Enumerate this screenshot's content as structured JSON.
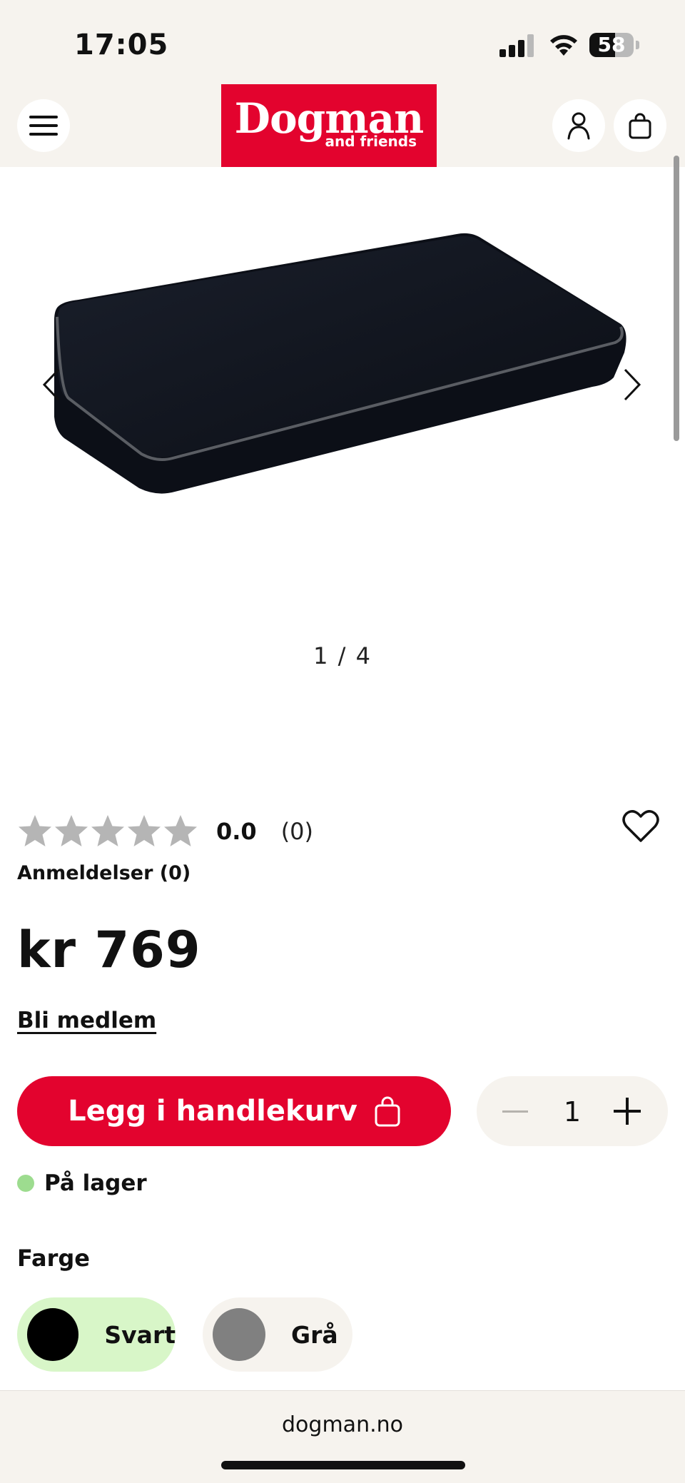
{
  "status_bar": {
    "time": "17:05",
    "battery_level": "58",
    "battery_fraction": 0.58
  },
  "header": {
    "logo_main": "Dogman",
    "logo_sub": "and friends",
    "brand_color": "#e3032e"
  },
  "gallery": {
    "counter": "1 / 4",
    "current_image": 1,
    "total_images": 4
  },
  "product": {
    "rating_value": "0.0",
    "rating_count": "(0)",
    "stars_filled": 0,
    "stars_total": 5,
    "reviews_link": "Anmeldelser (0)",
    "price": "kr 769",
    "member_link": "Bli medlem"
  },
  "purchase": {
    "add_to_cart_label": "Legg i handlekurv",
    "quantity": "1"
  },
  "stock": {
    "label": "På lager",
    "status_color": "#9ddc8f"
  },
  "color_selector": {
    "title": "Farge",
    "options": [
      {
        "label": "Svart",
        "swatch": "#000000",
        "selected": true
      },
      {
        "label": "Grå",
        "swatch": "#808080",
        "selected": false
      }
    ]
  },
  "browser": {
    "domain": "dogman.no"
  },
  "icons": [
    "menu-icon",
    "account-icon",
    "cart-icon",
    "chevron-left-icon",
    "chevron-right-icon",
    "star-icon",
    "heart-icon",
    "bag-icon",
    "minus-icon",
    "plus-icon"
  ]
}
